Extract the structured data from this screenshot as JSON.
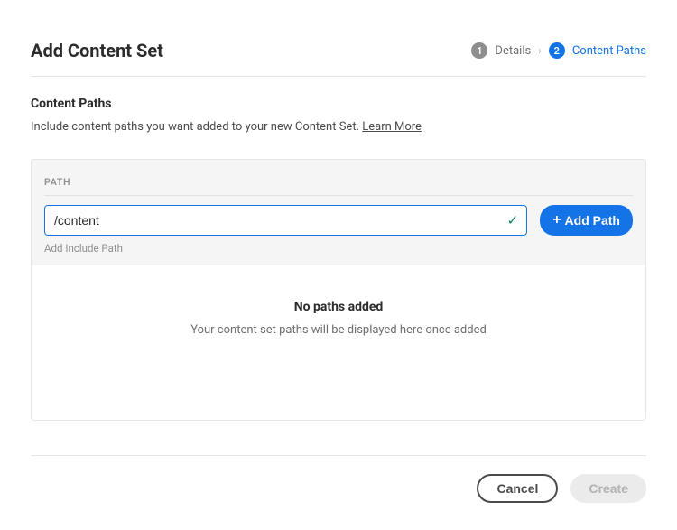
{
  "header": {
    "title": "Add Content Set",
    "steps": [
      {
        "num": "1",
        "label": "Details",
        "active": false
      },
      {
        "num": "2",
        "label": "Content Paths",
        "active": true
      }
    ]
  },
  "section": {
    "title": "Content Paths",
    "subtitle_prefix": "Include content paths you want added to your new Content Set. ",
    "learn_more": "Learn More"
  },
  "table": {
    "path_header": "PATH",
    "input_value": "/content",
    "helper": "Add Include Path",
    "add_btn": "Add Path"
  },
  "empty": {
    "title": "No paths added",
    "subtitle": "Your content set paths will be displayed here once added"
  },
  "footer": {
    "cancel": "Cancel",
    "create": "Create"
  }
}
